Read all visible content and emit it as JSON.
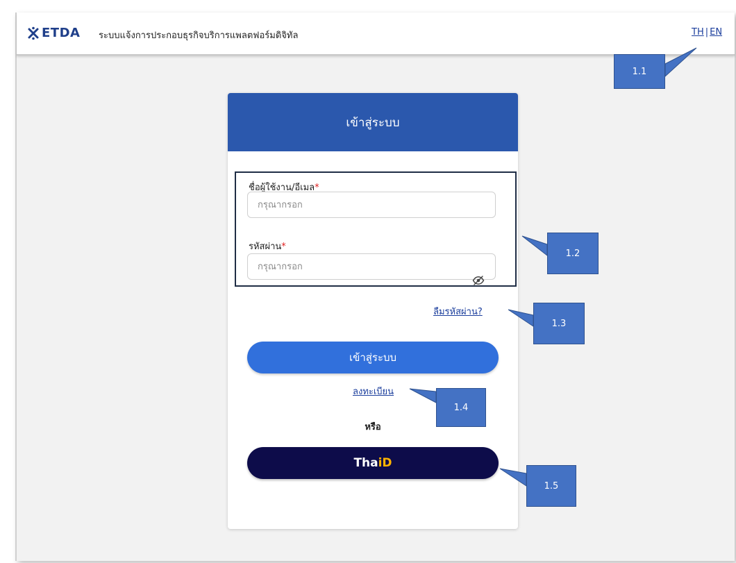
{
  "header": {
    "logo_text": "ETDA",
    "app_title": "ระบบแจ้งการประกอบธุรกิจบริการแพลตฟอร์มดิจิทัล",
    "lang_th": "TH",
    "lang_sep": "|",
    "lang_en": "EN",
    "brand_color": "#1f3f8a"
  },
  "login": {
    "title": "เข้าสู่ระบบ",
    "username_label": "ชื่อผู้ใช้งาน/อีเมล",
    "username_placeholder": "กรุณากรอก",
    "password_label": "รหัสผ่าน",
    "password_placeholder": "กรุณากรอก",
    "required_mark": "*",
    "forgot_password": "ลืมรหัสผ่าน?",
    "login_button": "เข้าสู่ระบบ",
    "register_link": "ลงทะเบียน",
    "or_text": "หรือ",
    "thaid_prefix": "Tha",
    "thaid_accent": "iD",
    "header_color": "#2b58ad",
    "button_color": "#3170dc",
    "thaid_color": "#0d0c4a"
  },
  "callouts": [
    {
      "label": "1.1"
    },
    {
      "label": "1.2"
    },
    {
      "label": "1.3"
    },
    {
      "label": "1.4"
    },
    {
      "label": "1.5"
    }
  ],
  "icons": {
    "logo": "etda-logo-icon",
    "password_toggle": "eye-off-icon"
  }
}
